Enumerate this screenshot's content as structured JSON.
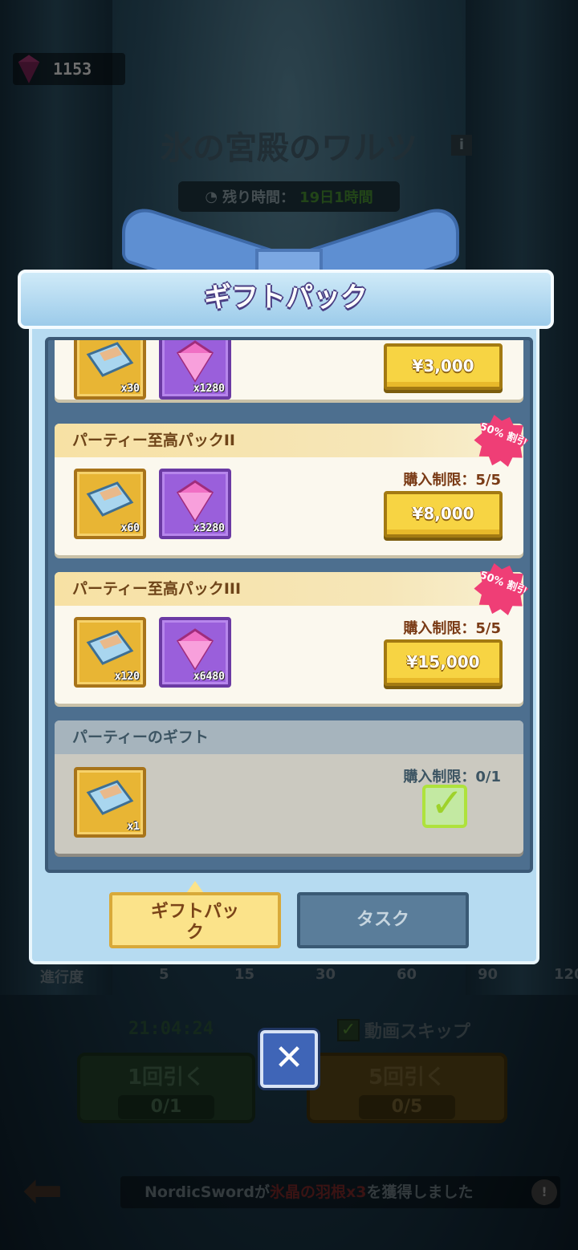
{
  "currency": {
    "gems": "1153"
  },
  "event": {
    "title": "氷の宮殿のワルツ",
    "time_label": "残り時間：",
    "time_value": "19日1時間"
  },
  "progress": {
    "label": "進行度",
    "ticks": [
      "5",
      "15",
      "30",
      "60",
      "90",
      "120"
    ]
  },
  "draw": {
    "timer": "21:04:24",
    "skip_label": "動画スキップ",
    "one_label": "1回引く",
    "one_count": "0/1",
    "five_label": "5回引く",
    "five_count": "0/5"
  },
  "news": {
    "player": "NordicSword",
    "mid": "が",
    "item": "氷晶の羽根x3",
    "end": "を獲得しました"
  },
  "modal": {
    "title": "ギフトパック",
    "packs": [
      {
        "name": "",
        "items": [
          {
            "qty": "x30",
            "kind": "ticket"
          },
          {
            "qty": "x1280",
            "kind": "gem"
          }
        ],
        "price": "¥3,000"
      },
      {
        "name": "パーティー至高パックII",
        "limit": "購入制限：5/5",
        "discount": "50% 割引",
        "items": [
          {
            "qty": "x60",
            "kind": "ticket"
          },
          {
            "qty": "x3280",
            "kind": "gem"
          }
        ],
        "price": "¥8,000"
      },
      {
        "name": "パーティー至高パックIII",
        "limit": "購入制限：5/5",
        "discount": "50% 割引",
        "items": [
          {
            "qty": "x120",
            "kind": "ticket"
          },
          {
            "qty": "x6480",
            "kind": "gem"
          }
        ],
        "price": "¥15,000"
      },
      {
        "name": "パーティーのギフト",
        "limit": "購入制限：0/1",
        "items": [
          {
            "qty": "x1",
            "kind": "ticket"
          }
        ],
        "status": "claimed"
      }
    ],
    "tabs": {
      "gift": "ギフトパッ\nク",
      "task": "タスク"
    }
  },
  "colors": {
    "accent_gold": "#f7d443",
    "gem_purple": "#9a5fdb",
    "discount_pink": "#ef3e76",
    "claimed_green": "#aee23c"
  }
}
